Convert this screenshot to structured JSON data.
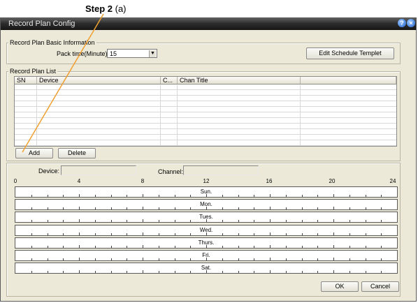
{
  "callout": {
    "bold": "Step 2",
    "rest": " (a)"
  },
  "window": {
    "title": "Record Plan Config",
    "help": "?",
    "close": "×"
  },
  "basic": {
    "legend": "Record Plan Basic Information",
    "pack_label": "Pack time(Minute):",
    "pack_value": "15",
    "edit_button": "Edit Schedule Templet"
  },
  "list": {
    "legend": "Record Plan List",
    "columns": [
      "SN",
      "Device",
      "C...",
      "Chan Title",
      ""
    ],
    "add": "Add",
    "delete": "Delete"
  },
  "schedule": {
    "device_label": "Device:",
    "channel_label": "Channel:",
    "device_value": "",
    "channel_value": "",
    "ticks": [
      "0",
      "4",
      "8",
      "12",
      "16",
      "20",
      "24"
    ],
    "days": [
      "Sun.",
      "Mon.",
      "Tues.",
      "Wed.",
      "Thurs.",
      "Fri.",
      "Sat."
    ]
  },
  "footer": {
    "ok": "OK",
    "cancel": "Cancel"
  },
  "colors": {
    "callout_line": "#f0a030",
    "titlebar": "#2c2c2c",
    "dialog_bg": "#ece9d8"
  }
}
